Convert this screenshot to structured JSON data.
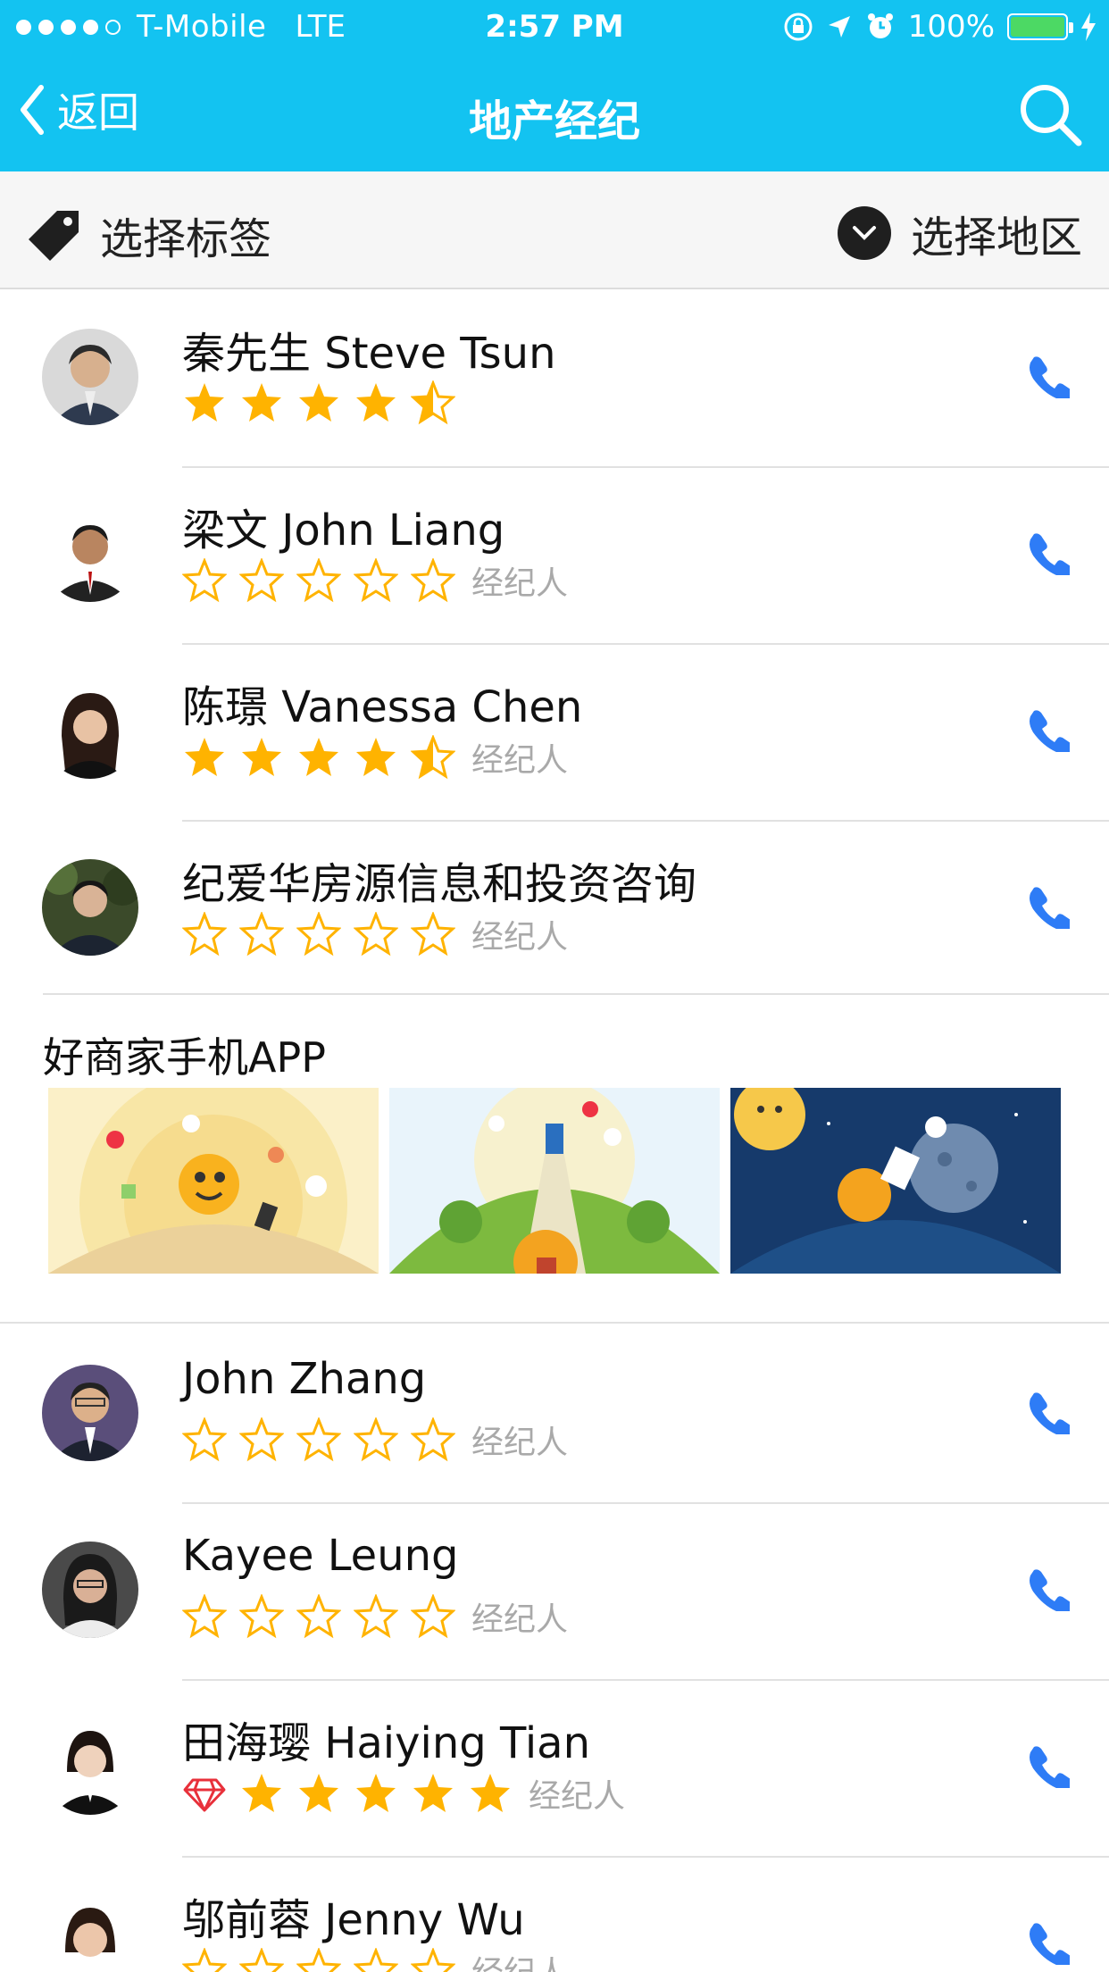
{
  "status_bar": {
    "carrier": "T-Mobile",
    "network": "LTE",
    "time": "2:57 PM",
    "battery": "100%",
    "battery_level": 1.0
  },
  "nav": {
    "back_label": "返回",
    "title": "地产经纪",
    "search_icon": "search-icon"
  },
  "filter": {
    "tag_label": "选择标签",
    "region_label": "选择地区"
  },
  "agents": [
    {
      "name": "秦先生 Steve Tsun",
      "rating": 4.5,
      "role": "",
      "badge": ""
    },
    {
      "name": "梁文 John Liang",
      "rating": 0,
      "role": "经纪人",
      "badge": ""
    },
    {
      "name": "陈璟 Vanessa Chen",
      "rating": 4.5,
      "role": "经纪人",
      "badge": ""
    },
    {
      "name": "纪爱华房源信息和投资咨询",
      "rating": 0,
      "role": "经纪人",
      "badge": ""
    },
    {
      "name": "John Zhang",
      "rating": 0,
      "role": "经纪人",
      "badge": ""
    },
    {
      "name": "Kayee Leung",
      "rating": 0,
      "role": "经纪人",
      "badge": ""
    },
    {
      "name": "田海璎 Haiying Tian",
      "rating": 5,
      "role": "经纪人",
      "badge": "diamond-icon"
    },
    {
      "name": "邬前蓉 Jenny Wu",
      "rating": 0,
      "role": "经纪人",
      "badge": ""
    }
  ],
  "banner": {
    "title": "好商家手机APP"
  },
  "colors": {
    "accent": "#13C3F1",
    "star": "#FFB300",
    "phone": "#2E7CF6"
  }
}
